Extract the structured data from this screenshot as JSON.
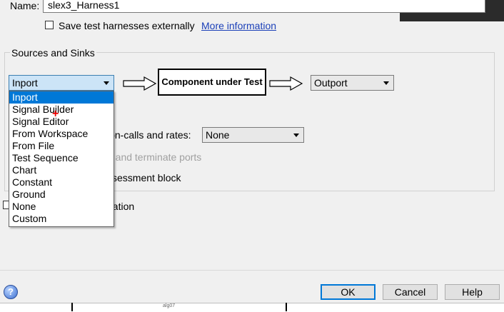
{
  "watermark": "...",
  "name": {
    "label": "Name:",
    "value": "slex3_Harness1"
  },
  "save_externally": {
    "label": "Save test harnesses externally",
    "checked": false
  },
  "more_info": "More information",
  "sources_sinks": {
    "title": "Sources and Sinks",
    "source_value": "Inport",
    "component_label": "Component under Test",
    "sink_value": "Outport",
    "source_options": [
      "Inport",
      "Signal Builder",
      "Signal Editor",
      "From Workspace",
      "From File",
      "Test Sequence",
      "Chart",
      "Constant",
      "Ground",
      "None",
      "Custom"
    ],
    "selected_index": 0
  },
  "function_calls": {
    "label_visible": "ion-calls and rates:",
    "value": "None"
  },
  "ports_label_visible": "t, and terminate ports",
  "assessment_label_visible": "ssessment block",
  "creation_label_visible": "eation",
  "buttons": {
    "ok": "OK",
    "cancel": "Cancel",
    "help": "Help"
  },
  "help_icon_glyph": "?",
  "bottom_text": "alg07"
}
